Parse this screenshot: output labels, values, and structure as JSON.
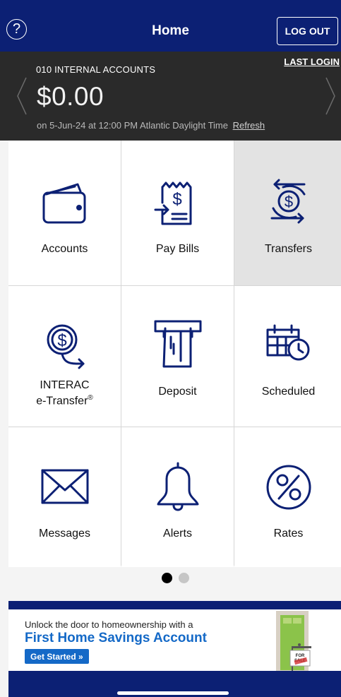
{
  "header": {
    "title": "Home",
    "help_icon_text": "?",
    "logout_label": "LOG OUT",
    "bg_color": "#0c2074"
  },
  "account": {
    "name": "010 INTERNAL ACCOUNTS",
    "last_login_label": "LAST LOGIN",
    "balance": "$0.00",
    "as_of": "on 5-Jun-24 at 12:00 PM Atlantic Daylight Time",
    "refresh_label": "Refresh",
    "bg_color": "#2a2a2a"
  },
  "tiles": [
    {
      "label": "Accounts",
      "icon": "wallet-icon",
      "active": false
    },
    {
      "label": "Pay Bills",
      "icon": "bill-icon",
      "active": false
    },
    {
      "label": "Transfers",
      "icon": "transfer-icon",
      "active": true
    },
    {
      "label_line1": "INTERAC",
      "label_line2": "e-Transfer",
      "label_sup": "®",
      "icon": "etransfer-icon",
      "active": false
    },
    {
      "label": "Deposit",
      "icon": "atm-deposit-icon",
      "active": false
    },
    {
      "label": "Scheduled",
      "icon": "calendar-clock-icon",
      "active": false
    },
    {
      "label": "Messages",
      "icon": "envelope-icon",
      "active": false
    },
    {
      "label": "Alerts",
      "icon": "bell-icon",
      "active": false
    },
    {
      "label": "Rates",
      "icon": "percent-icon",
      "active": false
    }
  ],
  "pager": {
    "current_page": 1,
    "total_pages": 2
  },
  "promo": {
    "line1": "Unlock the door to homeownership with a",
    "line2": "First Home Savings Account",
    "cta": "Get Started »",
    "sign_text": "FOR SALE",
    "accent_color": "#1469c7"
  },
  "icon_color": "#0c2074"
}
